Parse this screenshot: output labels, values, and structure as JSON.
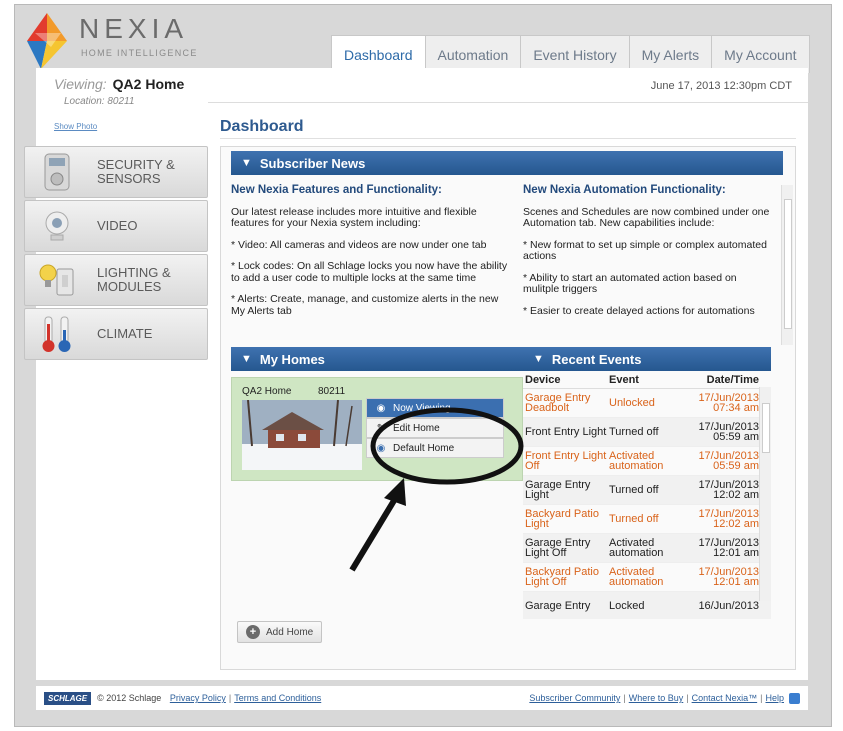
{
  "brand": {
    "name": "NEXIA",
    "tagline": "HOME INTELLIGENCE"
  },
  "tabs": [
    {
      "label": "Dashboard",
      "active": true
    },
    {
      "label": "Automation",
      "active": false
    },
    {
      "label": "Event History",
      "active": false
    },
    {
      "label": "My Alerts",
      "active": false
    },
    {
      "label": "My Account",
      "active": false
    }
  ],
  "viewing": {
    "prefix": "Viewing:",
    "home": "QA2 Home",
    "location_label": "Location:",
    "location": "80211",
    "show_photo": "Show Photo"
  },
  "datetime": "June 17, 2013  12:30pm CDT",
  "page_title": "Dashboard",
  "sidebar": {
    "items": [
      {
        "label_line1": "SECURITY &",
        "label_line2": "SENSORS",
        "icon": "security-sensor-icon"
      },
      {
        "label_line1": "VIDEO",
        "label_line2": "",
        "icon": "camera-icon"
      },
      {
        "label_line1": "LIGHTING &",
        "label_line2": "MODULES",
        "icon": "light-bulb-icon"
      },
      {
        "label_line1": "CLIMATE",
        "label_line2": "",
        "icon": "thermometer-icon"
      }
    ]
  },
  "news": {
    "title": "Subscriber News",
    "left_heading": "New Nexia Features and Functionality:",
    "left_paragraphs": [
      "Our latest release includes more intuitive and flexible features for your Nexia system including:",
      "* Video: All cameras and videos are now under one tab",
      "* Lock codes: On all Schlage locks you now have the ability to add a user code to multiple locks at the same time",
      "* Alerts: Create, manage, and customize alerts in the new My Alerts tab"
    ],
    "right_heading": "New Nexia Automation Functionality:",
    "right_paragraphs": [
      "Scenes and Schedules are now combined under one Automation tab. New capabilities include:",
      "* New format to set up simple or complex automated actions",
      "* Ability to start an automated action based on mulitple triggers",
      "* Easier to create delayed actions for automations"
    ]
  },
  "homes": {
    "title": "My Homes",
    "home_name": "QA2 Home",
    "home_zip": "80211",
    "menu": [
      "Now Viewing",
      "Edit Home",
      "Default Home"
    ],
    "add_home": "Add Home"
  },
  "events": {
    "title": "Recent Events",
    "headers": [
      "Device",
      "Event",
      "Date/Time"
    ],
    "rows": [
      {
        "device": "Garage Entry Deadbolt",
        "event": "Unlocked",
        "date": "17/Jun/2013",
        "time": "07:34 am",
        "warn": true
      },
      {
        "device": "Front Entry Light",
        "event": "Turned off",
        "date": "17/Jun/2013",
        "time": "05:59 am",
        "warn": false
      },
      {
        "device": "Front Entry Light Off",
        "event": "Activated automation",
        "date": "17/Jun/2013",
        "time": "05:59 am",
        "warn": true
      },
      {
        "device": "Garage Entry Light",
        "event": "Turned off",
        "date": "17/Jun/2013",
        "time": "12:02 am",
        "warn": false
      },
      {
        "device": "Backyard Patio Light",
        "event": "Turned off",
        "date": "17/Jun/2013",
        "time": "12:02 am",
        "warn": true
      },
      {
        "device": "Garage Entry Light Off",
        "event": "Activated automation",
        "date": "17/Jun/2013",
        "time": "12:01 am",
        "warn": false
      },
      {
        "device": "Backyard Patio Light Off",
        "event": "Activated automation",
        "date": "17/Jun/2013",
        "time": "12:01 am",
        "warn": true
      },
      {
        "device": "Garage Entry",
        "event": "Locked",
        "date": "16/Jun/2013",
        "time": "",
        "warn": false
      }
    ]
  },
  "footer": {
    "brand": "SCHLAGE",
    "copyright": "© 2012 Schlage",
    "privacy": "Privacy Policy",
    "terms": "Terms and Conditions",
    "community": "Subscriber Community",
    "where_to_buy": "Where to Buy",
    "contact": "Contact Nexia™",
    "help": "Help"
  },
  "colors": {
    "accent": "#2d6aa8",
    "bar": "#2f63a0",
    "warn": "#d9631a",
    "home_card": "#cfe6c3"
  }
}
